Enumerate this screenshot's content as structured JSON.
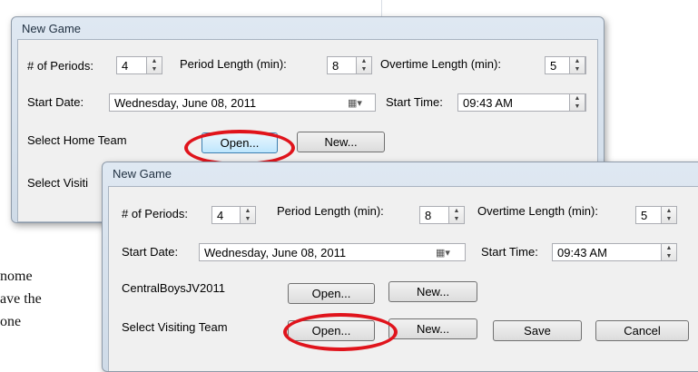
{
  "background_text": {
    "line1": "nome",
    "line2": "ave the",
    "line3": "one"
  },
  "dialog1": {
    "title": "New Game",
    "periods_label": "# of Periods:",
    "periods_value": "4",
    "period_length_label": "Period Length (min):",
    "period_length_value": "8",
    "overtime_label": "Overtime Length (min):",
    "overtime_value": "5",
    "start_date_label": "Start Date:",
    "start_date_value": "Wednesday,     June   08, 2011",
    "start_time_label": "Start Time:",
    "start_time_value": "09:43 AM",
    "home_label": "Select Home Team",
    "open_label": "Open...",
    "new_label": "New...",
    "visiting_label_partial": "Select Visiti"
  },
  "dialog2": {
    "title": "New Game",
    "periods_label": "# of Periods:",
    "periods_value": "4",
    "period_length_label": "Period Length (min):",
    "period_length_value": "8",
    "overtime_label": "Overtime Length (min):",
    "overtime_value": "5",
    "start_date_label": "Start Date:",
    "start_date_value": "Wednesday,     June   08, 2011",
    "start_time_label": "Start Time:",
    "start_time_value": "09:43 AM",
    "home_team_name": "CentralBoysJV2011",
    "open_label": "Open...",
    "new_label": "New...",
    "visiting_label": "Select Visiting Team",
    "open2_label": "Open...",
    "new2_label": "New...",
    "save_label": "Save",
    "cancel_label": "Cancel"
  },
  "icons": {
    "spin_up": "▲",
    "spin_down": "▼",
    "calendar": "calendar-dropdown-icon"
  },
  "colors": {
    "highlight_oval": "#e0141c",
    "focus_button": "#bee6fd"
  }
}
